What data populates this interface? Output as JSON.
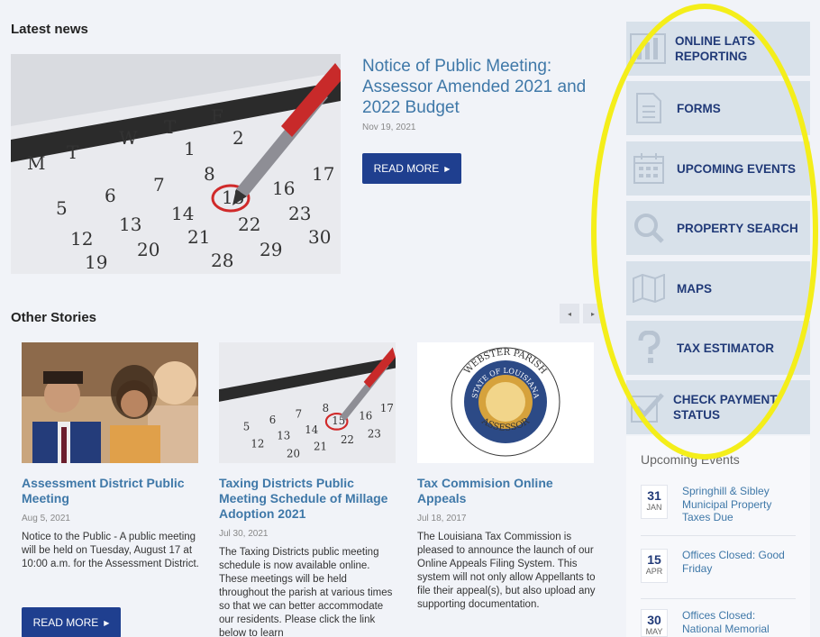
{
  "latest": {
    "heading": "Latest news",
    "title": "Notice of Public Meeting: Assessor Amended 2021 and 2022 Budget",
    "date": "Nov 19, 2021",
    "button": "READ MORE"
  },
  "other": {
    "heading": "Other Stories",
    "prev": "◂",
    "next": "▸",
    "stories": [
      {
        "title": "Assessment District Public Meeting",
        "date": "Aug 5, 2021",
        "body": "Notice to the Public - A public meeting will be held on Tuesday, August 17 at 10:00 a.m. for the Assessment District.",
        "button": "READ MORE"
      },
      {
        "title": "Taxing Districts Public Meeting Schedule of Millage Adoption 2021",
        "date": "Jul 30, 2021",
        "body": "The Taxing Districts public meeting schedule is now available online. These meetings will be held throughout the parish at various times so that we can better accommodate our residents. Please click the link below to learn"
      },
      {
        "title": "Tax Commision Online Appeals",
        "date": "Jul 18, 2017",
        "body": "The Louisiana Tax Commission is pleased to announce the launch of our Online Appeals Filing System. This system will not only allow Appellants to file their appeal(s), but also upload any supporting documentation.",
        "seal": {
          "top": "WEBSTER PARISH",
          "ring": "STATE OF LOUISIANA",
          "bottom": "ASSESSOR"
        }
      }
    ]
  },
  "sidebar": {
    "items": [
      {
        "label": "ONLINE LATS REPORTING",
        "icon": "chart-icon"
      },
      {
        "label": "FORMS",
        "icon": "document-icon"
      },
      {
        "label": "UPCOMING EVENTS",
        "icon": "calendar-icon"
      },
      {
        "label": "PROPERTY SEARCH",
        "icon": "search-icon"
      },
      {
        "label": "MAPS",
        "icon": "map-icon"
      },
      {
        "label": "TAX ESTIMATOR",
        "icon": "question-icon"
      },
      {
        "label": "CHECK PAYMENT STATUS",
        "icon": "check-icon"
      }
    ]
  },
  "events": {
    "heading": "Upcoming Events",
    "items": [
      {
        "day": "31",
        "month": "JAN",
        "title": "Springhill & Sibley Municipal Property Taxes Due"
      },
      {
        "day": "15",
        "month": "APR",
        "title": "Offices Closed: Good Friday"
      },
      {
        "day": "30",
        "month": "MAY",
        "title": "Offices Closed: National Memorial"
      }
    ]
  },
  "colors": {
    "accent": "#1f3f8f",
    "link": "#3f78a8",
    "highlight": "#f4ee1a",
    "tile": "#d8e1ea"
  }
}
